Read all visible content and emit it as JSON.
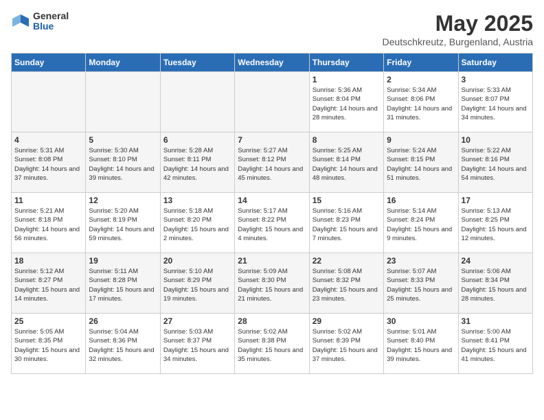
{
  "header": {
    "logo_general": "General",
    "logo_blue": "Blue",
    "month": "May 2025",
    "location": "Deutschkreutz, Burgenland, Austria"
  },
  "weekdays": [
    "Sunday",
    "Monday",
    "Tuesday",
    "Wednesday",
    "Thursday",
    "Friday",
    "Saturday"
  ],
  "weeks": [
    [
      {
        "day": "",
        "empty": true
      },
      {
        "day": "",
        "empty": true
      },
      {
        "day": "",
        "empty": true
      },
      {
        "day": "",
        "empty": true
      },
      {
        "day": "1",
        "sunrise": "5:36 AM",
        "sunset": "8:04 PM",
        "daylight": "14 hours and 28 minutes."
      },
      {
        "day": "2",
        "sunrise": "5:34 AM",
        "sunset": "8:06 PM",
        "daylight": "14 hours and 31 minutes."
      },
      {
        "day": "3",
        "sunrise": "5:33 AM",
        "sunset": "8:07 PM",
        "daylight": "14 hours and 34 minutes."
      }
    ],
    [
      {
        "day": "4",
        "sunrise": "5:31 AM",
        "sunset": "8:08 PM",
        "daylight": "14 hours and 37 minutes."
      },
      {
        "day": "5",
        "sunrise": "5:30 AM",
        "sunset": "8:10 PM",
        "daylight": "14 hours and 39 minutes."
      },
      {
        "day": "6",
        "sunrise": "5:28 AM",
        "sunset": "8:11 PM",
        "daylight": "14 hours and 42 minutes."
      },
      {
        "day": "7",
        "sunrise": "5:27 AM",
        "sunset": "8:12 PM",
        "daylight": "14 hours and 45 minutes."
      },
      {
        "day": "8",
        "sunrise": "5:25 AM",
        "sunset": "8:14 PM",
        "daylight": "14 hours and 48 minutes."
      },
      {
        "day": "9",
        "sunrise": "5:24 AM",
        "sunset": "8:15 PM",
        "daylight": "14 hours and 51 minutes."
      },
      {
        "day": "10",
        "sunrise": "5:22 AM",
        "sunset": "8:16 PM",
        "daylight": "14 hours and 54 minutes."
      }
    ],
    [
      {
        "day": "11",
        "sunrise": "5:21 AM",
        "sunset": "8:18 PM",
        "daylight": "14 hours and 56 minutes."
      },
      {
        "day": "12",
        "sunrise": "5:20 AM",
        "sunset": "8:19 PM",
        "daylight": "14 hours and 59 minutes."
      },
      {
        "day": "13",
        "sunrise": "5:18 AM",
        "sunset": "8:20 PM",
        "daylight": "15 hours and 2 minutes."
      },
      {
        "day": "14",
        "sunrise": "5:17 AM",
        "sunset": "8:22 PM",
        "daylight": "15 hours and 4 minutes."
      },
      {
        "day": "15",
        "sunrise": "5:16 AM",
        "sunset": "8:23 PM",
        "daylight": "15 hours and 7 minutes."
      },
      {
        "day": "16",
        "sunrise": "5:14 AM",
        "sunset": "8:24 PM",
        "daylight": "15 hours and 9 minutes."
      },
      {
        "day": "17",
        "sunrise": "5:13 AM",
        "sunset": "8:25 PM",
        "daylight": "15 hours and 12 minutes."
      }
    ],
    [
      {
        "day": "18",
        "sunrise": "5:12 AM",
        "sunset": "8:27 PM",
        "daylight": "15 hours and 14 minutes."
      },
      {
        "day": "19",
        "sunrise": "5:11 AM",
        "sunset": "8:28 PM",
        "daylight": "15 hours and 17 minutes."
      },
      {
        "day": "20",
        "sunrise": "5:10 AM",
        "sunset": "8:29 PM",
        "daylight": "15 hours and 19 minutes."
      },
      {
        "day": "21",
        "sunrise": "5:09 AM",
        "sunset": "8:30 PM",
        "daylight": "15 hours and 21 minutes."
      },
      {
        "day": "22",
        "sunrise": "5:08 AM",
        "sunset": "8:32 PM",
        "daylight": "15 hours and 23 minutes."
      },
      {
        "day": "23",
        "sunrise": "5:07 AM",
        "sunset": "8:33 PM",
        "daylight": "15 hours and 25 minutes."
      },
      {
        "day": "24",
        "sunrise": "5:06 AM",
        "sunset": "8:34 PM",
        "daylight": "15 hours and 28 minutes."
      }
    ],
    [
      {
        "day": "25",
        "sunrise": "5:05 AM",
        "sunset": "8:35 PM",
        "daylight": "15 hours and 30 minutes."
      },
      {
        "day": "26",
        "sunrise": "5:04 AM",
        "sunset": "8:36 PM",
        "daylight": "15 hours and 32 minutes."
      },
      {
        "day": "27",
        "sunrise": "5:03 AM",
        "sunset": "8:37 PM",
        "daylight": "15 hours and 34 minutes."
      },
      {
        "day": "28",
        "sunrise": "5:02 AM",
        "sunset": "8:38 PM",
        "daylight": "15 hours and 35 minutes."
      },
      {
        "day": "29",
        "sunrise": "5:02 AM",
        "sunset": "8:39 PM",
        "daylight": "15 hours and 37 minutes."
      },
      {
        "day": "30",
        "sunrise": "5:01 AM",
        "sunset": "8:40 PM",
        "daylight": "15 hours and 39 minutes."
      },
      {
        "day": "31",
        "sunrise": "5:00 AM",
        "sunset": "8:41 PM",
        "daylight": "15 hours and 41 minutes."
      }
    ]
  ],
  "labels": {
    "sunrise": "Sunrise:",
    "sunset": "Sunset:",
    "daylight": "Daylight:"
  }
}
